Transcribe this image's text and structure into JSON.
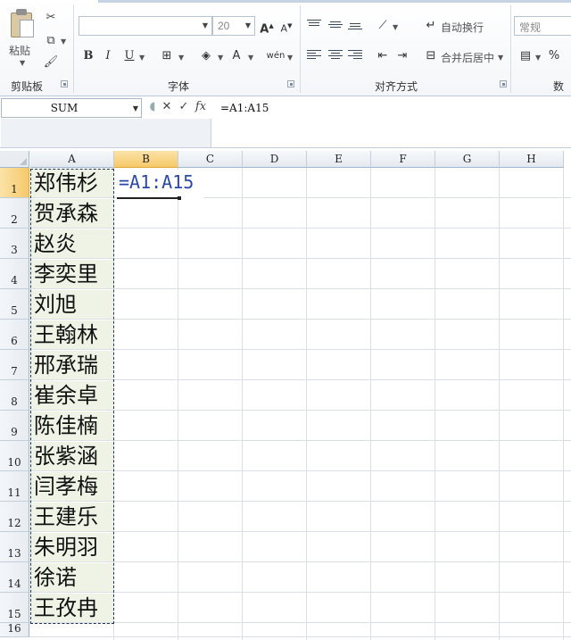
{
  "ribbon": {
    "clipboard": {
      "paste_label": "粘贴",
      "group_label": "剪贴板"
    },
    "font": {
      "font_name": "",
      "font_size": "20",
      "group_label": "字体",
      "bold": "B",
      "italic": "I",
      "underline": "U",
      "font_color": "A",
      "phonetic": "wén"
    },
    "alignment": {
      "wrap_text": "自动换行",
      "merge_center": "合并后居中",
      "group_label": "对齐方式"
    },
    "number": {
      "format": "常规",
      "percent": "%",
      "group_label": "数字"
    }
  },
  "formula_bar": {
    "name_box": "SUM",
    "cancel": "✕",
    "enter": "✓",
    "fx": "fx",
    "formula": "=A1:A15"
  },
  "sheet": {
    "columns": [
      "A",
      "B",
      "C",
      "D",
      "E",
      "F",
      "G",
      "H"
    ],
    "rows": [
      "1",
      "2",
      "3",
      "4",
      "5",
      "6",
      "7",
      "8",
      "9",
      "10",
      "11",
      "12",
      "13",
      "14",
      "15",
      "16"
    ],
    "column_a": [
      "郑伟杉",
      "贺承森",
      "赵炎",
      "李奕里",
      "刘旭",
      "王翰林",
      "邢承瑞",
      "崔余卓",
      "陈佳楠",
      "张紫涵",
      "闫孝梅",
      "王建乐",
      "朱明羽",
      "徐诺",
      "王孜冉"
    ],
    "b1_formula": "=A1:A15",
    "active_column": "B",
    "active_row": "1",
    "colors": {
      "selection_fill": "#eef3e6",
      "formula_text": "#2b4aa8",
      "header_active": "#f6c96a"
    }
  }
}
